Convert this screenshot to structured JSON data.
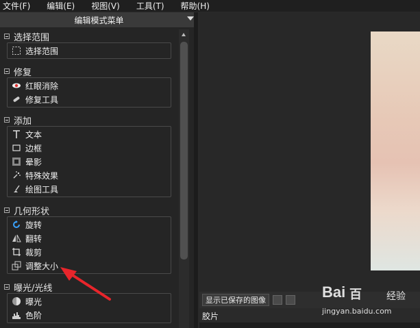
{
  "menubar": {
    "items": [
      "文件(F)",
      "编辑(E)",
      "视图(V)",
      "工具(T)",
      "帮助(H)"
    ]
  },
  "panel": {
    "title": "编辑模式菜单",
    "sections": [
      {
        "title": "选择范围",
        "items": [
          {
            "label": "选择范围",
            "icon": "selection-rect-icon"
          }
        ]
      },
      {
        "title": "修复",
        "items": [
          {
            "label": "红眼消除",
            "icon": "red-eye-icon"
          },
          {
            "label": "修复工具",
            "icon": "bandage-icon"
          }
        ]
      },
      {
        "title": "添加",
        "items": [
          {
            "label": "文本",
            "icon": "text-icon"
          },
          {
            "label": "边框",
            "icon": "frame-icon"
          },
          {
            "label": "晕影",
            "icon": "vignette-icon"
          },
          {
            "label": "特殊效果",
            "icon": "sparkle-icon"
          },
          {
            "label": "绘图工具",
            "icon": "brush-icon"
          }
        ]
      },
      {
        "title": "几何形状",
        "items": [
          {
            "label": "旋转",
            "icon": "rotate-icon"
          },
          {
            "label": "翻转",
            "icon": "flip-icon"
          },
          {
            "label": "裁剪",
            "icon": "crop-icon"
          },
          {
            "label": "调整大小",
            "icon": "resize-icon"
          }
        ]
      },
      {
        "title": "曝光/光线",
        "items": [
          {
            "label": "曝光",
            "icon": "exposure-icon"
          },
          {
            "label": "色阶",
            "icon": "levels-icon"
          }
        ]
      }
    ]
  },
  "viewer": {
    "show_saved_label": "显示已保存的图像",
    "filmstrip_label": "胶片"
  },
  "watermark": {
    "brand": "Bai",
    "brand2": "百",
    "cn": "经验",
    "url": "jingyan.baidu.com"
  },
  "colors": {
    "arrow": "#e8252b"
  }
}
